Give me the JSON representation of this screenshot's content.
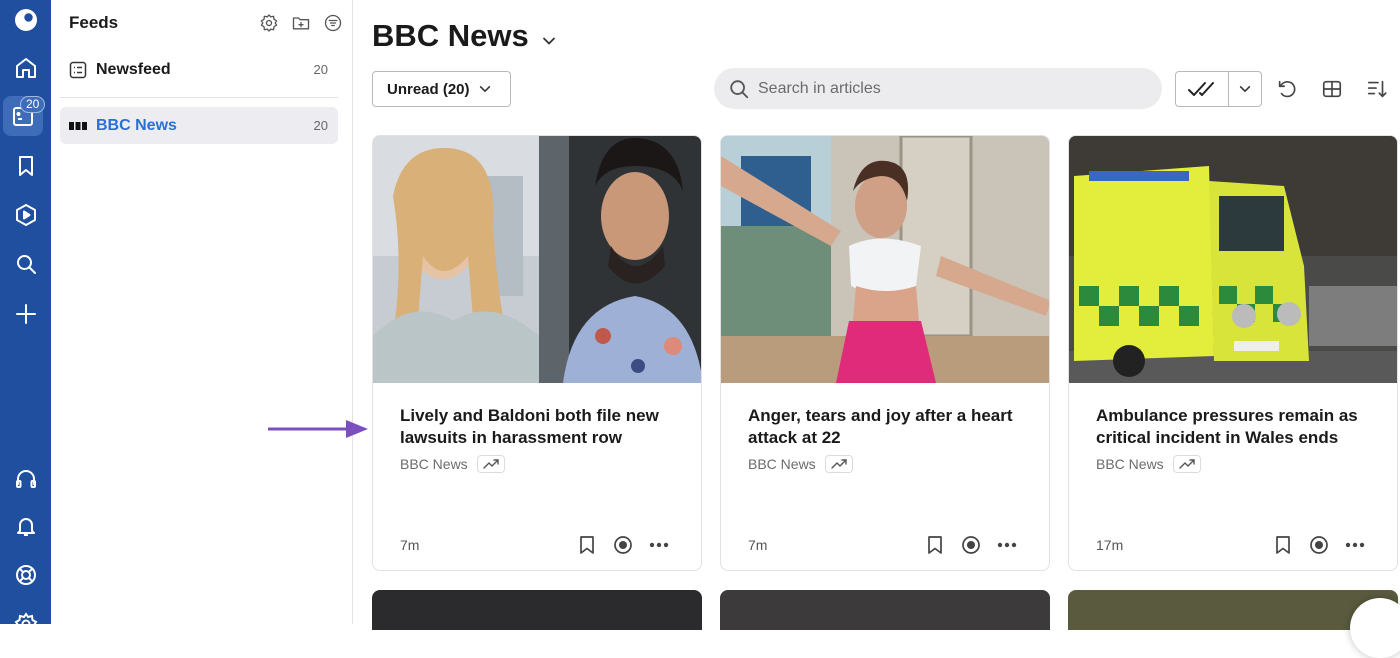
{
  "sidebar_rail": {
    "items": [
      {
        "name": "logo",
        "icon": "app-logo-icon"
      },
      {
        "name": "home",
        "icon": "home-icon"
      },
      {
        "name": "feeds",
        "icon": "feeds-icon",
        "badge": "20",
        "active": true
      },
      {
        "name": "saved",
        "icon": "bookmark-icon"
      },
      {
        "name": "sources",
        "icon": "hexagon-play-icon"
      },
      {
        "name": "search",
        "icon": "search-icon"
      },
      {
        "name": "add",
        "icon": "plus-icon"
      },
      {
        "name": "audio",
        "icon": "headphones-icon"
      },
      {
        "name": "notifications",
        "icon": "bell-icon"
      },
      {
        "name": "help",
        "icon": "lifebuoy-icon"
      },
      {
        "name": "settings",
        "icon": "gear-icon"
      }
    ],
    "colors": {
      "background": "#1f4f9e",
      "active": "#3e6cb9"
    }
  },
  "feeds_panel": {
    "title": "Feeds",
    "actions": [
      "settings-icon",
      "add-folder-icon",
      "filter-icon"
    ],
    "items": [
      {
        "label": "Newsfeed",
        "count": "20",
        "icon": "newsfeed-icon"
      },
      {
        "label": "BBC News",
        "count": "20",
        "icon": "bbc-logo-icon",
        "selected": true
      }
    ]
  },
  "main": {
    "title": "BBC News",
    "filter_button": "Unread (20)",
    "search_placeholder": "Search in articles",
    "toolbar": [
      "mark-all-read-icon",
      "refresh-icon",
      "layout-icon",
      "sort-icon"
    ],
    "accent_color": "#2b6fd6"
  },
  "articles": [
    {
      "title": "Lively and Baldoni both file new lawsuits in harassment row",
      "source": "BBC News",
      "time": "7m"
    },
    {
      "title": "Anger, tears and joy after a heart attack at 22",
      "source": "BBC News",
      "time": "7m"
    },
    {
      "title": "Ambulance pressures remain as critical incident in Wales ends",
      "source": "BBC News",
      "time": "17m"
    }
  ],
  "annotation": {
    "arrow_color": "#7b4fc0"
  }
}
